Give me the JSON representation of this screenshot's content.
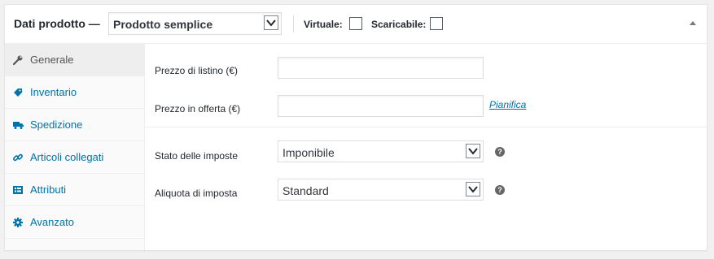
{
  "header": {
    "title": "Dati prodotto —",
    "product_type": "Prodotto semplice",
    "virtual_label": "Virtuale:",
    "downloadable_label": "Scaricabile:"
  },
  "tabs": [
    {
      "label": "Generale",
      "icon": "wrench-icon",
      "active": true
    },
    {
      "label": "Inventario",
      "icon": "tag-icon",
      "active": false
    },
    {
      "label": "Spedizione",
      "icon": "truck-icon",
      "active": false
    },
    {
      "label": "Articoli collegati",
      "icon": "link-icon",
      "active": false
    },
    {
      "label": "Attributi",
      "icon": "list-icon",
      "active": false
    },
    {
      "label": "Avanzato",
      "icon": "gear-icon",
      "active": false
    }
  ],
  "general": {
    "regular_price_label": "Prezzo di listino (€)",
    "regular_price_value": "",
    "sale_price_label": "Prezzo in offerta (€)",
    "sale_price_value": "",
    "schedule_link": "Pianifica",
    "tax_status_label": "Stato delle imposte",
    "tax_status_value": "Imponibile",
    "tax_class_label": "Aliquota di imposta",
    "tax_class_value": "Standard",
    "help_glyph": "?"
  },
  "colors": {
    "link": "#0073aa",
    "tab_active_bg": "#eeeeee",
    "sidebar_bg": "#fafafa"
  }
}
